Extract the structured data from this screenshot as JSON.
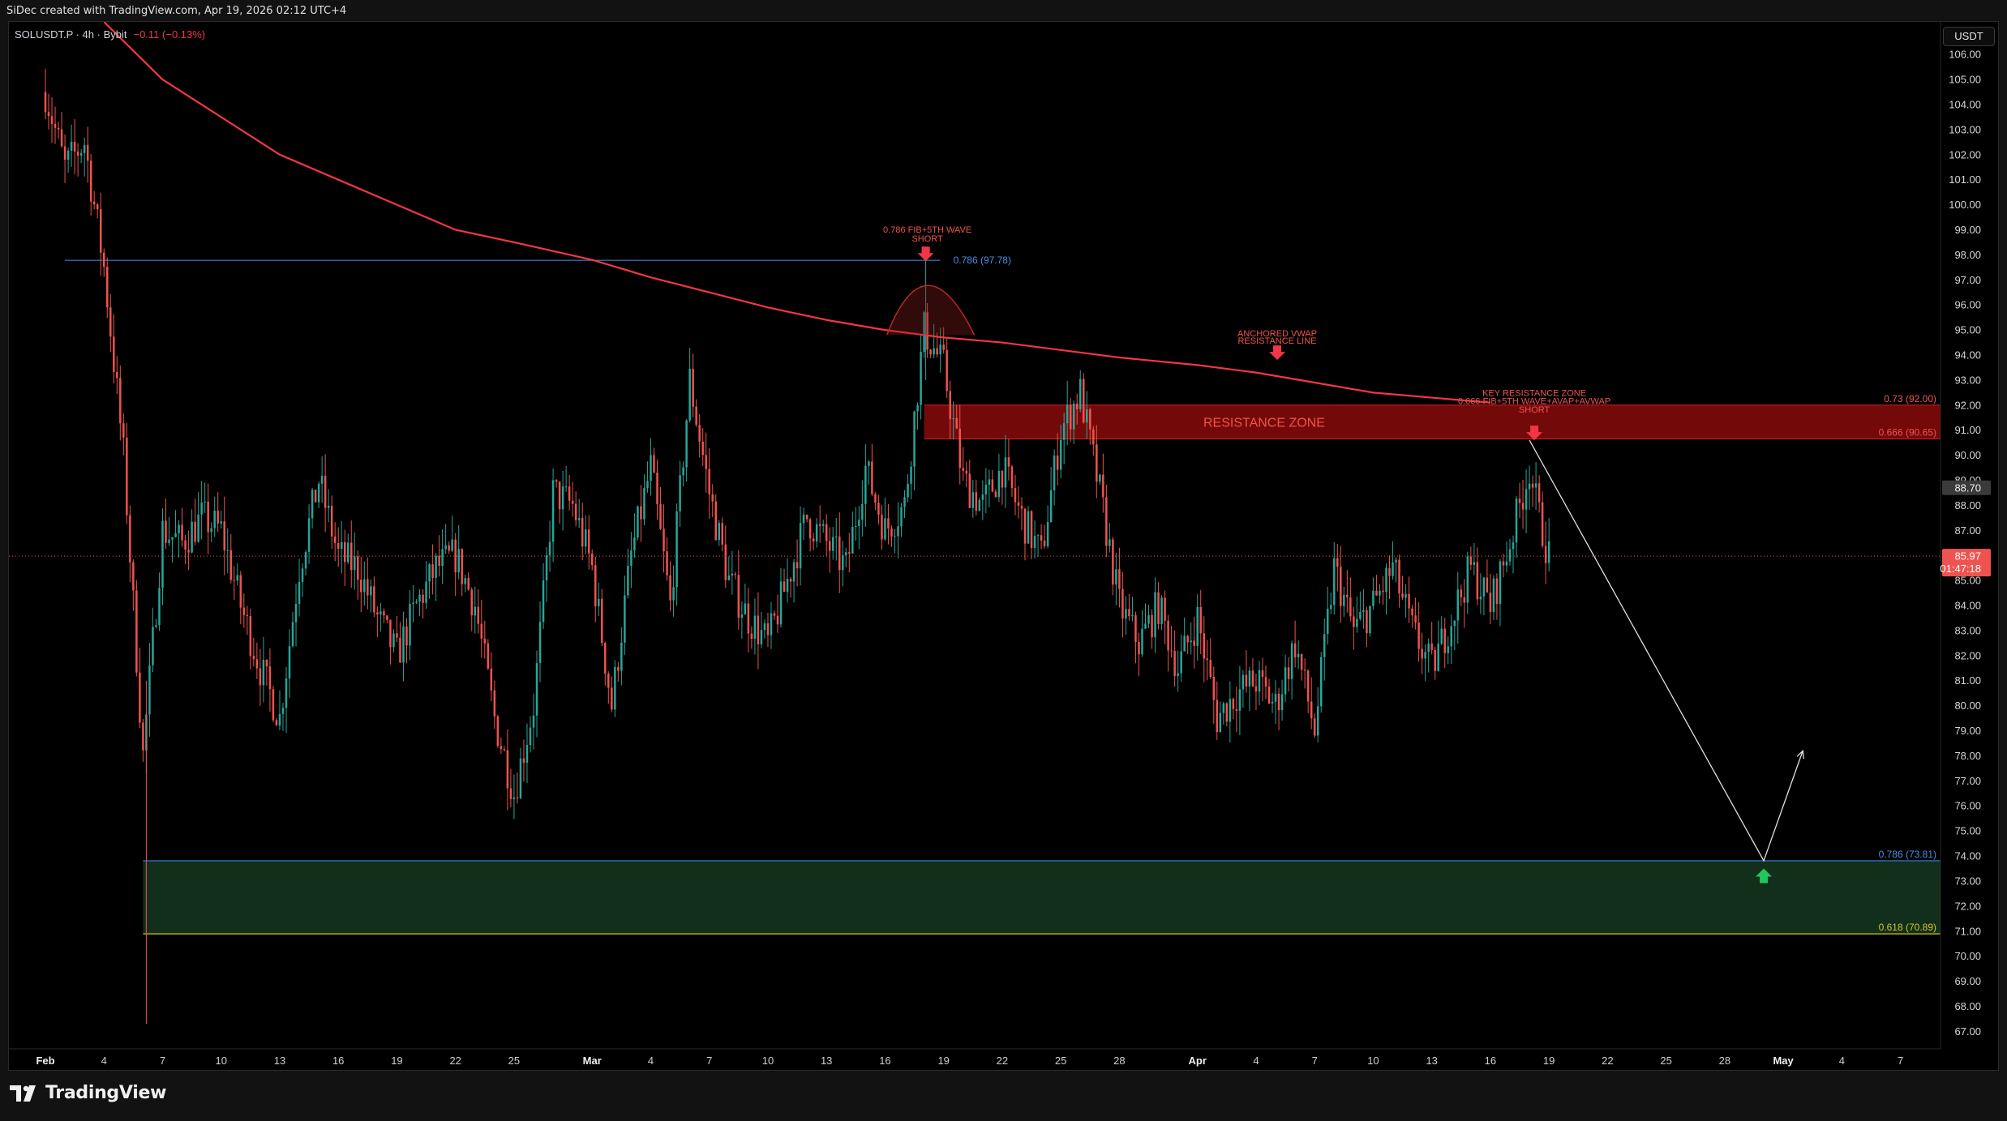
{
  "header": {
    "credit": "SiDec created with TradingView.com, Apr 19, 2026 02:12 UTC+4",
    "currency_button": "USDT"
  },
  "symbol": {
    "ticker": "SOLUSDT.P · 4h · Bybit",
    "change": "−0.11 (−0.13%)"
  },
  "branding": {
    "name": "TradingView"
  },
  "colors": {
    "background": "#000000",
    "up": "#26a69a",
    "down": "#ef5350",
    "vwap": "#f23645",
    "fib_blue": "#2962ff",
    "fib_yellow": "#d4c72a",
    "resistance_zone": "#7a0a0a",
    "support_zone": "#12311c",
    "projection": "#e0e0e0"
  },
  "chart_data": {
    "type": "candlestick",
    "symbol": "SOLUSDT.P",
    "timeframe": "4h",
    "exchange": "Bybit",
    "y_axis": {
      "range": [
        66.3,
        107.3
      ],
      "ticks": [
        "106.00",
        "105.00",
        "104.00",
        "103.00",
        "102.00",
        "101.00",
        "100.00",
        "99.00",
        "98.00",
        "97.00",
        "96.00",
        "95.00",
        "94.00",
        "93.00",
        "92.00",
        "91.00",
        "90.00",
        "89.00",
        "88.00",
        "87.00",
        "86.00",
        "85.00",
        "84.00",
        "83.00",
        "82.00",
        "81.00",
        "80.00",
        "79.00",
        "78.00",
        "77.00",
        "76.00",
        "75.00",
        "74.00",
        "73.00",
        "72.00",
        "71.00",
        "70.00",
        "69.00",
        "68.00",
        "67.00"
      ],
      "tick_values": [
        106,
        105,
        104,
        103,
        102,
        101,
        100,
        99,
        98,
        97,
        96,
        95,
        94,
        93,
        92,
        91,
        90,
        89,
        88,
        87,
        86,
        85,
        84,
        83,
        82,
        81,
        80,
        79,
        78,
        77,
        76,
        75,
        74,
        73,
        72,
        71,
        70,
        69,
        68,
        67
      ]
    },
    "x_axis": {
      "labels": [
        "Feb",
        "4",
        "7",
        "10",
        "13",
        "16",
        "19",
        "22",
        "25",
        "Mar",
        "4",
        "7",
        "10",
        "13",
        "16",
        "19",
        "22",
        "25",
        "28",
        "Apr",
        "4",
        "7",
        "10",
        "13",
        "16",
        "19",
        "22",
        "25",
        "28",
        "May",
        "4",
        "7"
      ],
      "dates": [
        "2026-02-01",
        "2026-02-04",
        "2026-02-07",
        "2026-02-10",
        "2026-02-13",
        "2026-02-16",
        "2026-02-19",
        "2026-02-22",
        "2026-02-25",
        "2026-03-01",
        "2026-03-04",
        "2026-03-07",
        "2026-03-10",
        "2026-03-13",
        "2026-03-16",
        "2026-03-19",
        "2026-03-22",
        "2026-03-25",
        "2026-03-28",
        "2026-04-01",
        "2026-04-04",
        "2026-04-07",
        "2026-04-10",
        "2026-04-13",
        "2026-04-16",
        "2026-04-19",
        "2026-04-22",
        "2026-04-25",
        "2026-04-28",
        "2026-05-01",
        "2026-05-04",
        "2026-05-07"
      ],
      "bold": [
        "Feb",
        "Mar",
        "Apr",
        "May"
      ]
    },
    "price_path": [
      [
        "2026-02-01",
        104.5
      ],
      [
        "2026-02-02",
        101.5
      ],
      [
        "2026-02-03",
        102.5
      ],
      [
        "2026-02-04",
        97.5
      ],
      [
        "2026-02-05",
        90.0
      ],
      [
        "2026-02-06",
        78.0
      ],
      [
        "2026-02-07",
        87.0
      ],
      [
        "2026-02-08",
        86.5
      ],
      [
        "2026-02-09",
        87.5
      ],
      [
        "2026-02-10",
        87.0
      ],
      [
        "2026-02-11",
        84.0
      ],
      [
        "2026-02-12",
        81.5
      ],
      [
        "2026-02-13",
        79.5
      ],
      [
        "2026-02-14",
        85.5
      ],
      [
        "2026-02-15",
        89.0
      ],
      [
        "2026-02-16",
        86.0
      ],
      [
        "2026-02-17",
        85.5
      ],
      [
        "2026-02-18",
        83.5
      ],
      [
        "2026-02-19",
        82.0
      ],
      [
        "2026-02-20",
        84.0
      ],
      [
        "2026-02-21",
        85.5
      ],
      [
        "2026-02-22",
        86.0
      ],
      [
        "2026-02-23",
        84.0
      ],
      [
        "2026-02-24",
        79.5
      ],
      [
        "2026-02-25",
        76.5
      ],
      [
        "2026-02-26",
        80.0
      ],
      [
        "2026-02-27",
        88.5
      ],
      [
        "2026-02-28",
        88.0
      ],
      [
        "2026-03-01",
        85.5
      ],
      [
        "2026-03-02",
        80.0
      ],
      [
        "2026-03-03",
        86.0
      ],
      [
        "2026-03-04",
        89.5
      ],
      [
        "2026-03-05",
        84.0
      ],
      [
        "2026-03-06",
        93.0
      ],
      [
        "2026-03-07",
        88.5
      ],
      [
        "2026-03-08",
        85.0
      ],
      [
        "2026-03-09",
        83.5
      ],
      [
        "2026-03-10",
        82.5
      ],
      [
        "2026-03-11",
        85.0
      ],
      [
        "2026-03-12",
        87.5
      ],
      [
        "2026-03-13",
        86.5
      ],
      [
        "2026-03-14",
        85.5
      ],
      [
        "2026-03-15",
        89.5
      ],
      [
        "2026-03-16",
        87.0
      ],
      [
        "2026-03-17",
        88.0
      ],
      [
        "2026-03-18",
        95.0
      ],
      [
        "2026-03-19",
        93.5
      ],
      [
        "2026-03-20",
        89.0
      ],
      [
        "2026-03-21",
        88.0
      ],
      [
        "2026-03-22",
        89.5
      ],
      [
        "2026-03-23",
        87.5
      ],
      [
        "2026-03-24",
        86.0
      ],
      [
        "2026-03-25",
        91.0
      ],
      [
        "2026-03-26",
        92.5
      ],
      [
        "2026-03-27",
        88.5
      ],
      [
        "2026-03-28",
        84.0
      ],
      [
        "2026-03-29",
        82.5
      ],
      [
        "2026-03-30",
        84.0
      ],
      [
        "2026-03-31",
        81.5
      ],
      [
        "2026-04-01",
        83.5
      ],
      [
        "2026-04-02",
        79.5
      ],
      [
        "2026-04-03",
        80.5
      ],
      [
        "2026-04-04",
        81.0
      ],
      [
        "2026-04-05",
        80.0
      ],
      [
        "2026-04-06",
        82.5
      ],
      [
        "2026-04-07",
        79.0
      ],
      [
        "2026-04-08",
        85.5
      ],
      [
        "2026-04-09",
        83.0
      ],
      [
        "2026-04-10",
        84.0
      ],
      [
        "2026-04-11",
        85.5
      ],
      [
        "2026-04-12",
        83.0
      ],
      [
        "2026-04-13",
        81.5
      ],
      [
        "2026-04-14",
        83.5
      ],
      [
        "2026-04-15",
        85.5
      ],
      [
        "2026-04-16",
        84.0
      ],
      [
        "2026-04-17",
        86.5
      ],
      [
        "2026-04-18",
        89.5
      ],
      [
        "2026-04-18T12",
        87.5
      ],
      [
        "2026-04-19",
        85.97
      ]
    ],
    "anchored_vwap": [
      [
        "2026-02-04",
        107.3
      ],
      [
        "2026-02-07",
        105.0
      ],
      [
        "2026-02-10",
        103.5
      ],
      [
        "2026-02-13",
        102.0
      ],
      [
        "2026-02-16",
        101.0
      ],
      [
        "2026-02-19",
        100.0
      ],
      [
        "2026-02-22",
        99.0
      ],
      [
        "2026-02-25",
        98.5
      ],
      [
        "2026-03-01",
        97.8
      ],
      [
        "2026-03-04",
        97.1
      ],
      [
        "2026-03-07",
        96.5
      ],
      [
        "2026-03-10",
        95.9
      ],
      [
        "2026-03-13",
        95.4
      ],
      [
        "2026-03-16",
        95.0
      ],
      [
        "2026-03-19",
        94.7
      ],
      [
        "2026-03-22",
        94.5
      ],
      [
        "2026-03-25",
        94.2
      ],
      [
        "2026-03-28",
        93.9
      ],
      [
        "2026-04-01",
        93.6
      ],
      [
        "2026-04-04",
        93.3
      ],
      [
        "2026-04-07",
        92.9
      ],
      [
        "2026-04-10",
        92.5
      ],
      [
        "2026-04-13",
        92.3
      ],
      [
        "2026-04-16",
        92.1
      ]
    ],
    "last_price": "85.97",
    "countdown": "01:47:18",
    "price_marker": "88.70",
    "annotations": {
      "fib_short_top": {
        "line1": "0.786 FIB+5TH WAVE",
        "line2": "SHORT",
        "date": "2026-03-18",
        "price": 97.78
      },
      "fib_786_upper_label": "0.786 (97.78)",
      "fib_786_upper_value": 97.78,
      "fib_786_upper_from": "2026-02-02",
      "vwap_label_line1": "ANCHORED VWAP",
      "vwap_label_line2": "RESISTANCE LINE",
      "vwap_label_date": "2026-04-05",
      "key_zone_line1": "KEY RESISTANCE ZONE",
      "key_zone_line2": "0.666 FIB+5TH WAVE+AVAP+AVWAP",
      "key_zone_line3": "SHORT",
      "key_zone_date": "2026-04-18",
      "resistance_zone_label": "RESISTANCE ZONE",
      "resistance_zone": {
        "top": 92.0,
        "bottom": 90.65,
        "from": "2026-03-18"
      },
      "level_073_label": "0.73 (92.00)",
      "level_0666_label": "0.666 (90.65)",
      "support_zone": {
        "top": 73.81,
        "bottom": 70.89,
        "from": "2026-02-06"
      },
      "level_0786_low_label": "0.786 (73.81)",
      "level_0618_label": "0.618 (70.89)",
      "projection": [
        [
          "2026-04-18",
          90.6
        ],
        [
          "2026-04-30",
          73.81
        ],
        [
          "2026-05-02",
          78.2
        ]
      ]
    }
  }
}
